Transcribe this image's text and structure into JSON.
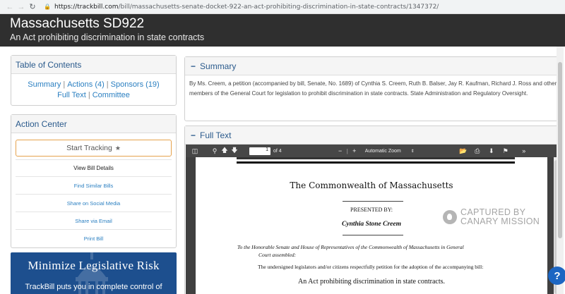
{
  "browser": {
    "url_host": "https://trackbill.com",
    "url_path": "/bill/massachusetts-senate-docket-922-an-act-prohibiting-discrimination-in-state-contracts/1347372/"
  },
  "header": {
    "title": "Massachusetts SD922",
    "subtitle": "An Act prohibiting discrimination in state contracts"
  },
  "toc": {
    "title": "Table of Contents",
    "links": [
      "Summary",
      "Actions (4)",
      "Sponsors (19)",
      "Full Text",
      "Committee"
    ]
  },
  "action_center": {
    "title": "Action Center",
    "track_label": "Start Tracking",
    "items": [
      "View Bill Details",
      "Find Similar Bills",
      "Share on Social Media",
      "Share via Email",
      "Print Bill"
    ]
  },
  "promo": {
    "title": "Minimize Legislative Risk",
    "text": "TrackBill puts you in complete control of"
  },
  "summary": {
    "title": "Summary",
    "text": "By Ms. Creem, a petition (accompanied by bill, Senate, No. 1689) of Cynthia S. Creem, Ruth B. Balser, Jay R. Kaufman, Richard J. Ross and other members of the General Court for legislation to prohibit discrimination in state contracts.  State Administration and Regulatory Oversight."
  },
  "fulltext": {
    "title": "Full Text",
    "page_current": "1",
    "page_total": "of 4",
    "zoom": "Automatic Zoom"
  },
  "document": {
    "commonwealth": "The Commonwealth of Massachusetts",
    "presented_by": "PRESENTED BY:",
    "sponsor": "Cynthia Stone Creem",
    "honorable_line1": "To the Honorable Senate and House of Representatives of the Commonwealth of Massachusetts in General",
    "honorable_line2": "Court assembled:",
    "undersigned": "The undersigned legislators and/or citizens respectfully petition for the adoption of the accompanying bill:",
    "act_title": "An Act prohibiting discrimination in state contracts."
  },
  "watermark": {
    "line1": "CAPTURED BY",
    "line2": "CANARY MISSION"
  },
  "help_label": "?"
}
